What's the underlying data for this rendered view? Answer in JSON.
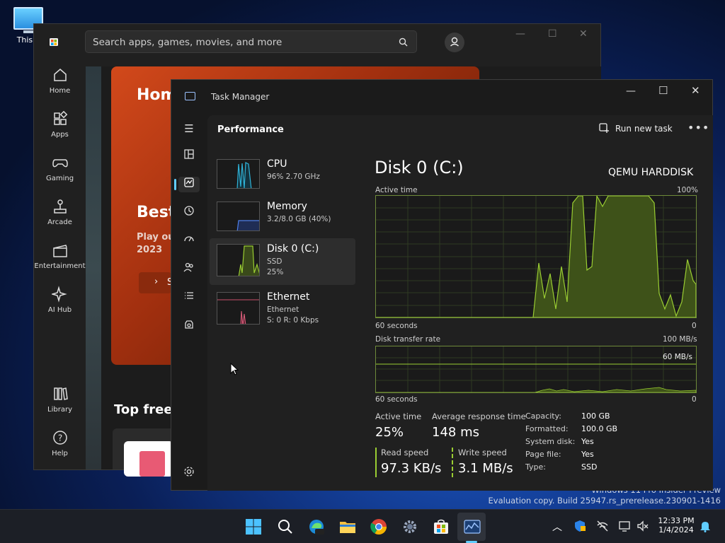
{
  "desktop": {
    "icon_label": "This P"
  },
  "watermark": {
    "line1": "Windows 11 Pro Insider Preview",
    "line2": "Evaluation copy. Build 25947.rs_prerelease.230901-1416"
  },
  "store": {
    "search_placeholder": "Search apps, games, movies, and more",
    "nav": [
      {
        "label": "Home"
      },
      {
        "label": "Apps"
      },
      {
        "label": "Gaming"
      },
      {
        "label": "Arcade"
      },
      {
        "label": "Entertainment"
      },
      {
        "label": "AI Hub"
      },
      {
        "label": "Library"
      },
      {
        "label": "Help"
      }
    ],
    "hero_title": "Hom",
    "hero_subtitle": "Best",
    "hero_text1": "Play ou",
    "hero_text2": "2023",
    "hero_button": "S",
    "section_title": "Top free a"
  },
  "taskmanager": {
    "title": "Task Manager",
    "section": "Performance",
    "run_new_task": "Run new task",
    "tiles": [
      {
        "name": "CPU",
        "sub1": "96% 2.70 GHz",
        "sub2": "",
        "sub3": ""
      },
      {
        "name": "Memory",
        "sub1": "3.2/8.0 GB (40%)",
        "sub2": "",
        "sub3": ""
      },
      {
        "name": "Disk 0 (C:)",
        "sub1": "SSD",
        "sub2": "25%",
        "sub3": ""
      },
      {
        "name": "Ethernet",
        "sub1": "Ethernet",
        "sub2": "S: 0 R: 0 Kbps",
        "sub3": ""
      }
    ],
    "disk": {
      "title": "Disk 0 (C:)",
      "model": "QEMU HARDDISK",
      "active_time_label": "Active time",
      "active_time_max": "100%",
      "graph1_left": "60 seconds",
      "graph1_right": "0",
      "transfer_label": "Disk transfer rate",
      "transfer_max": "100 MB/s",
      "transfer_line": "60 MB/s",
      "graph2_left": "60 seconds",
      "graph2_right": "0",
      "stats": {
        "active_label": "Active time",
        "active_value": "25%",
        "response_label": "Average response time",
        "response_value": "148 ms",
        "read_label": "Read speed",
        "read_value": "97.3 KB/s",
        "write_label": "Write speed",
        "write_value": "3.1 MB/s"
      },
      "props": [
        {
          "k": "Capacity:",
          "v": "100 GB"
        },
        {
          "k": "Formatted:",
          "v": "100.0 GB"
        },
        {
          "k": "System disk:",
          "v": "Yes"
        },
        {
          "k": "Page file:",
          "v": "Yes"
        },
        {
          "k": "Type:",
          "v": "SSD"
        }
      ]
    }
  },
  "taskbar": {
    "time": "12:33 PM",
    "date": "1/4/2024"
  }
}
